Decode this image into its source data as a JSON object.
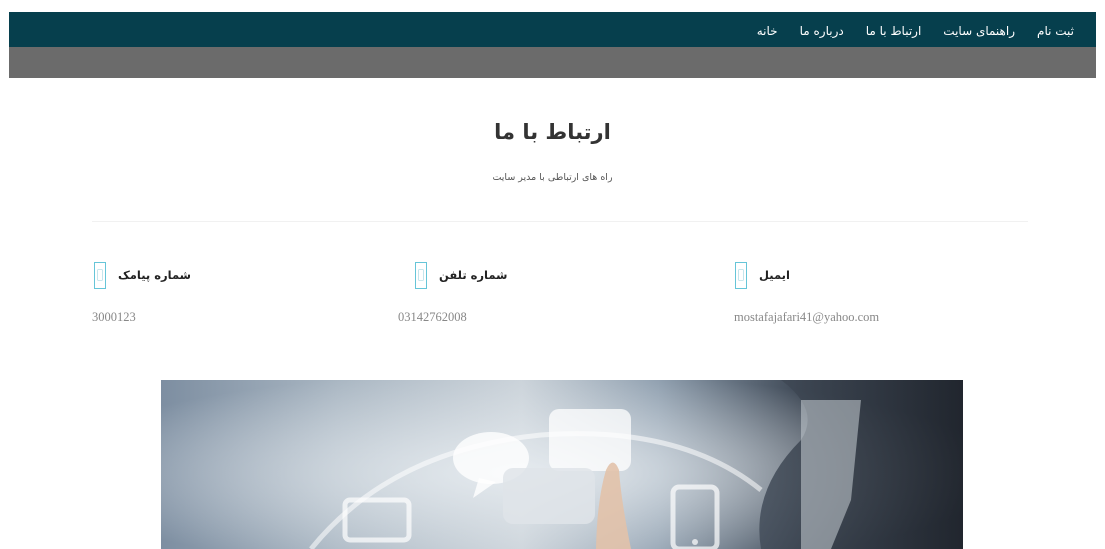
{
  "nav": {
    "items": [
      {
        "label": "خانه",
        "name": "nav-home"
      },
      {
        "label": "درباره ما",
        "name": "nav-about"
      },
      {
        "label": "ارتباط با ما",
        "name": "nav-contact"
      },
      {
        "label": "راهنمای سایت",
        "name": "nav-guide"
      },
      {
        "label": "ثبت نام",
        "name": "nav-register"
      }
    ]
  },
  "page": {
    "title": "ارتباط با ما",
    "subtitle": "راه های ارتباطی با مدیر سایت"
  },
  "contacts": {
    "email": {
      "label": "ایمیل",
      "value": "mostafajafari41@yahoo.com",
      "icon": "email-icon"
    },
    "phone": {
      "label": "شماره تلفن",
      "value": "03142762008",
      "icon": "phone-icon"
    },
    "sms": {
      "label": "شماره پیامک",
      "value": "3000123",
      "icon": "sms-icon"
    }
  },
  "colors": {
    "header": "#063f4d",
    "header_band": "#6b6b6b",
    "icon_border": "#66c5d8"
  }
}
